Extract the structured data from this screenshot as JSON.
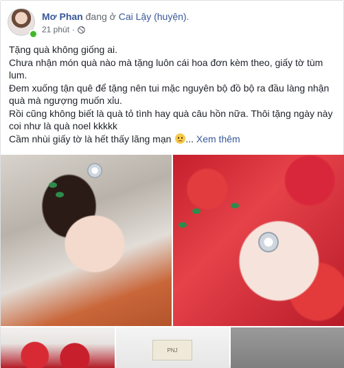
{
  "header": {
    "author": "Mơ Phan",
    "checkin_prefix": "đang ở",
    "place": "Cai Lậy (huyện).",
    "time": "21 phút",
    "separator": "·",
    "privacy_icon": "globe-icon"
  },
  "post": {
    "lines": [
      "Tặng quà không giống ai.",
      "Chưa nhận món quà nào mà tặng luôn cái hoa đơn kèm theo, giấy tờ tùm lum.",
      "Đem xuống tận quê để tặng nên tui mặc nguyên bộ đồ bộ ra đầu làng nhận quà mà ngượng muốn xỉu.",
      "Rồi cũng không biết là quà tỏ tình hay quà câu hồn nữa. Thôi tặng ngày này coi như là quà noel kkkkk",
      "Cầm nhùi giấy tờ là hết thấy lãng mạn"
    ],
    "ellipsis": "...",
    "see_more": "Xem thêm"
  },
  "photos": {
    "box_label": "PNJ"
  },
  "colors": {
    "link": "#385898",
    "online": "#42b72a",
    "meta": "#616770"
  }
}
